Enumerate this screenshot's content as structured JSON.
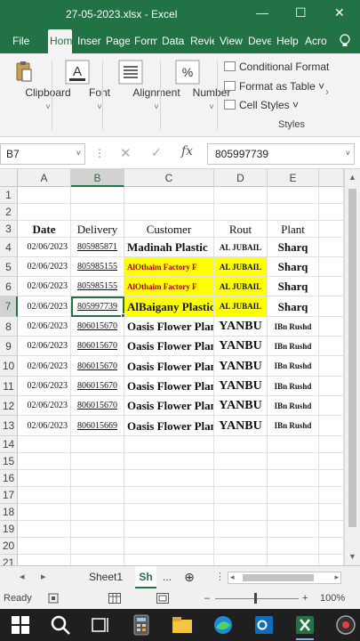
{
  "window": {
    "title": "27-05-2023.xlsx  -  Excel",
    "minimize_glyph": "—",
    "maximize_glyph": "☐",
    "close_glyph": "✕"
  },
  "tabs": [
    {
      "label": "File"
    },
    {
      "label": "Hom"
    },
    {
      "label": "Inser"
    },
    {
      "label": "Page"
    },
    {
      "label": "Form"
    },
    {
      "label": "Data"
    },
    {
      "label": "Revie"
    },
    {
      "label": "View"
    },
    {
      "label": "Deve"
    },
    {
      "label": "Help"
    },
    {
      "label": "Acro"
    }
  ],
  "ribbon": {
    "clipboard": "Clipboard",
    "font": "Font",
    "alignment": "Alignment",
    "number": "Number",
    "number_glyph": "%",
    "font_glyph": "A",
    "conditional_formatting": "Conditional Format",
    "format_as_table": "Format as Table ˅",
    "cell_styles": "Cell Styles ˅",
    "styles_group": "Styles",
    "chevron": "˅",
    "scroll_right": "›"
  },
  "formula_bar": {
    "name_box": "B7",
    "dots": "⋮",
    "cancel_glyph": "✕",
    "enter_glyph": "✓",
    "fx_label": "fx",
    "value": "805997739",
    "dropdown_glyph": "˅"
  },
  "columns": [
    "A",
    "B",
    "C",
    "D",
    "E"
  ],
  "rows": [
    "1",
    "2",
    "3",
    "4",
    "5",
    "6",
    "7",
    "8",
    "9",
    "10",
    "11",
    "12",
    "13",
    "14",
    "15",
    "16",
    "17",
    "18",
    "19",
    "20",
    "21"
  ],
  "headers": {
    "date": "Date",
    "delivery": "Delivery",
    "customer": "Customer",
    "rout": "Rout",
    "plant": "Plant"
  },
  "data_rows": [
    {
      "date": "02/06/2023",
      "delivery": "805985871",
      "customer": "Madinah Plastic",
      "rout": "AL JUBAIL",
      "plant": "Sharq"
    },
    {
      "date": "02/06/2023",
      "delivery": "805985155",
      "customer": "AlOthaim Factory F",
      "rout": "AL JUBAIL",
      "plant": "Sharq"
    },
    {
      "date": "02/06/2023",
      "delivery": "805985155",
      "customer": "AlOthaim Factory F",
      "rout": "AL JUBAIL",
      "plant": "Sharq"
    },
    {
      "date": "02/06/2023",
      "delivery": "805997739",
      "customer": "AlBaigany Plastic",
      "rout": "AL JUBAIL",
      "plant": "Sharq"
    },
    {
      "date": "02/06/2023",
      "delivery": "806015670",
      "customer": "Oasis Flower Plant",
      "rout": "YANBU",
      "plant": "IBn Rushd"
    },
    {
      "date": "02/06/2023",
      "delivery": "806015670",
      "customer": "Oasis Flower Plant",
      "rout": "YANBU",
      "plant": "IBn Rushd"
    },
    {
      "date": "02/06/2023",
      "delivery": "806015670",
      "customer": "Oasis Flower Plant",
      "rout": "YANBU",
      "plant": "IBn Rushd"
    },
    {
      "date": "02/06/2023",
      "delivery": "806015670",
      "customer": "Oasis Flower Plant",
      "rout": "YANBU",
      "plant": "IBn Rushd"
    },
    {
      "date": "02/06/2023",
      "delivery": "806015670",
      "customer": "Oasis Flower Plant",
      "rout": "YANBU",
      "plant": "IBn Rushd"
    },
    {
      "date": "02/06/2023",
      "delivery": "806015669",
      "customer": "Oasis Flower Plant",
      "rout": "YANBU",
      "plant": "IBn Rushd"
    }
  ],
  "sheets": {
    "prev_glyph": "◂",
    "next_glyph": "▸",
    "sheet1": "Sheet1",
    "active": "Sh",
    "more": "...",
    "add_glyph": "⊕",
    "scroll_left": "◂",
    "scroll_right": "▸"
  },
  "status": {
    "ready": "Ready",
    "zoom_minus": "–",
    "zoom_plus": "+",
    "zoom": "100%"
  },
  "colors": {
    "excel_green": "#217346",
    "highlight_yellow": "#ffff00"
  }
}
